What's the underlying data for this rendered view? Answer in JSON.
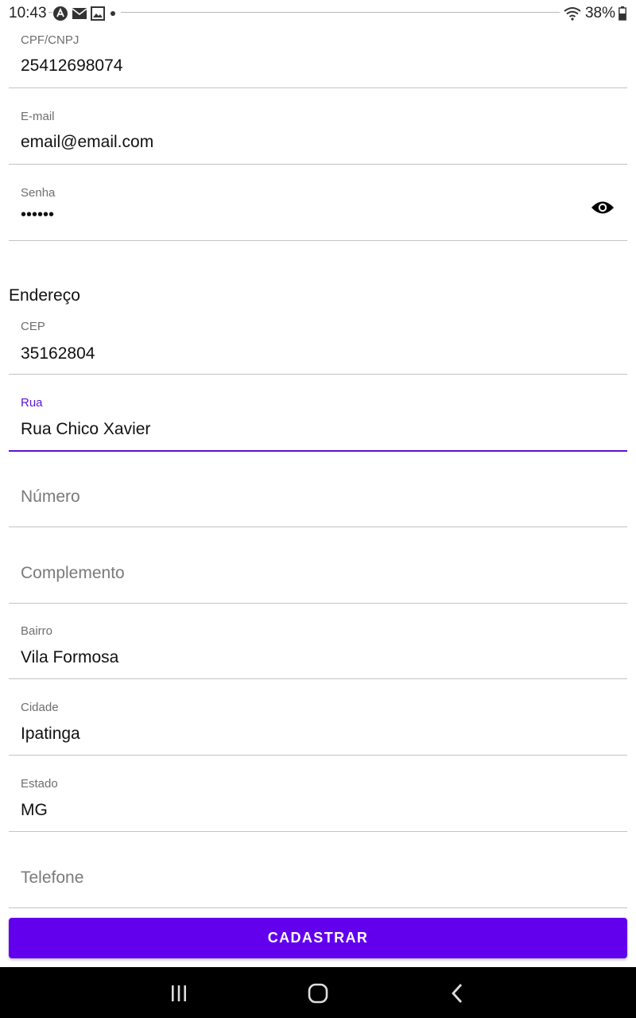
{
  "status": {
    "time": "10:43",
    "battery": "38%",
    "icons": [
      "app-notification-icon",
      "mail-icon",
      "image-icon",
      "dot-icon",
      "wifi-icon",
      "battery-icon"
    ]
  },
  "form": {
    "cpf": {
      "label": "CPF/CNPJ",
      "value": "25412698074"
    },
    "email": {
      "label": "E-mail",
      "value": "email@email.com"
    },
    "password": {
      "label": "Senha",
      "value": "••••••"
    },
    "address_title": "Endereço",
    "cep": {
      "label": "CEP",
      "value": "35162804"
    },
    "street": {
      "label": "Rua",
      "value": "Rua Chico Xavier"
    },
    "number": {
      "placeholder": "Número"
    },
    "complement": {
      "placeholder": "Complemento"
    },
    "neighborhood": {
      "label": "Bairro",
      "value": "Vila Formosa"
    },
    "city": {
      "label": "Cidade",
      "value": "Ipatinga"
    },
    "state": {
      "label": "Estado",
      "value": "MG"
    },
    "phone": {
      "placeholder": "Telefone"
    },
    "submit_label": "CADASTRAR"
  },
  "colors": {
    "accent": "#6200ee",
    "focus": "#5b12d6"
  }
}
